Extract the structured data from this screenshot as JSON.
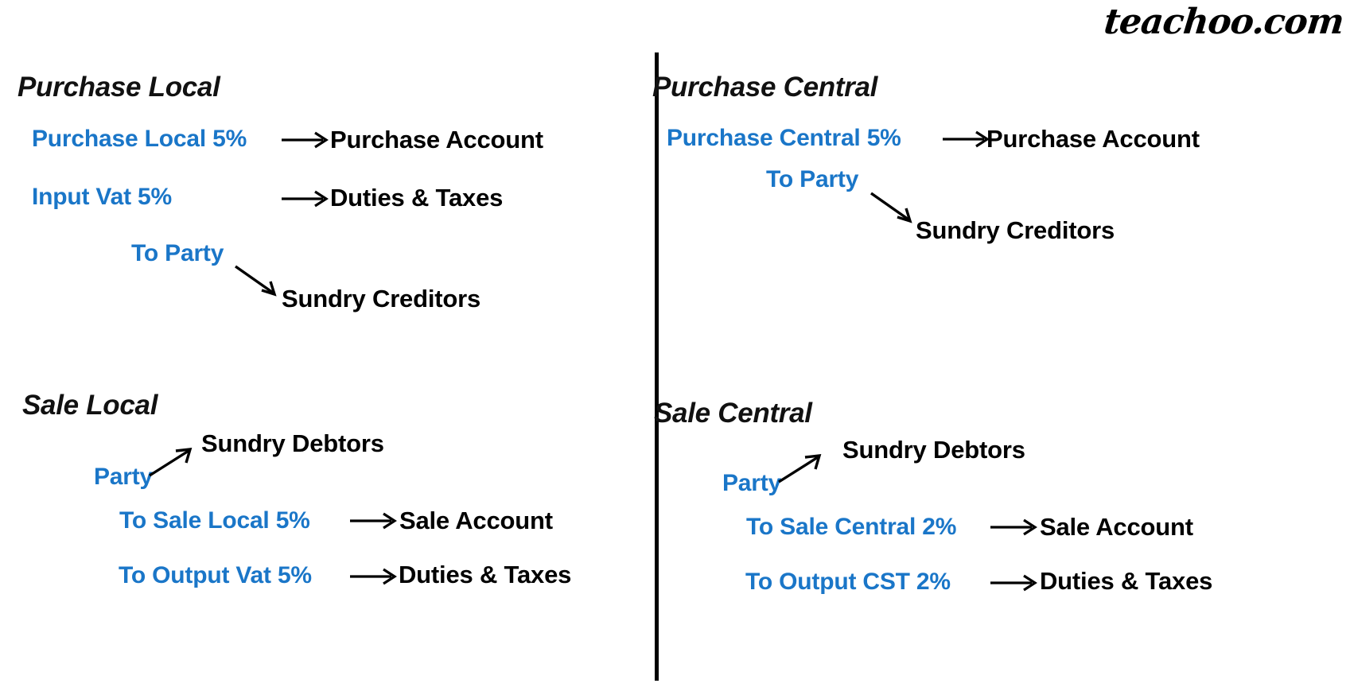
{
  "brand": {
    "text": "teachoo.com"
  },
  "colors": {
    "accent_blue": "#1a76c8",
    "text_black": "#000000",
    "divider": "#000000",
    "background": "#ffffff"
  },
  "sections": [
    {
      "id": "purchase-local",
      "heading": "Purchase Local",
      "rows": [
        {
          "source": "Purchase Local 5%",
          "arrow": "right",
          "target": "Purchase Account"
        },
        {
          "source": "Input Vat 5%",
          "arrow": "right",
          "target": "Duties & Taxes"
        },
        {
          "source": "To Party",
          "arrow": "down-right",
          "target": "Sundry Creditors"
        }
      ]
    },
    {
      "id": "purchase-central",
      "heading": "Purchase Central",
      "rows": [
        {
          "source": "Purchase Central 5%",
          "arrow": "right",
          "target": "Purchase Account"
        },
        {
          "source": "To Party",
          "arrow": "down-right",
          "target": "Sundry Creditors"
        }
      ]
    },
    {
      "id": "sale-local",
      "heading": "Sale Local",
      "rows": [
        {
          "source": "Party",
          "arrow": "up-right",
          "target": "Sundry Debtors"
        },
        {
          "source": "To Sale Local 5%",
          "arrow": "right",
          "target": "Sale Account"
        },
        {
          "source": "To Output Vat 5%",
          "arrow": "right",
          "target": "Duties & Taxes"
        }
      ]
    },
    {
      "id": "sale-central",
      "heading": "Sale Central",
      "rows": [
        {
          "source": "Party",
          "arrow": "up-right",
          "target": "Sundry Debtors"
        },
        {
          "source": "To Sale Central 2%",
          "arrow": "right",
          "target": "Sale Account"
        },
        {
          "source": "To Output CST 2%",
          "arrow": "right",
          "target": "Duties & Taxes"
        }
      ]
    }
  ]
}
